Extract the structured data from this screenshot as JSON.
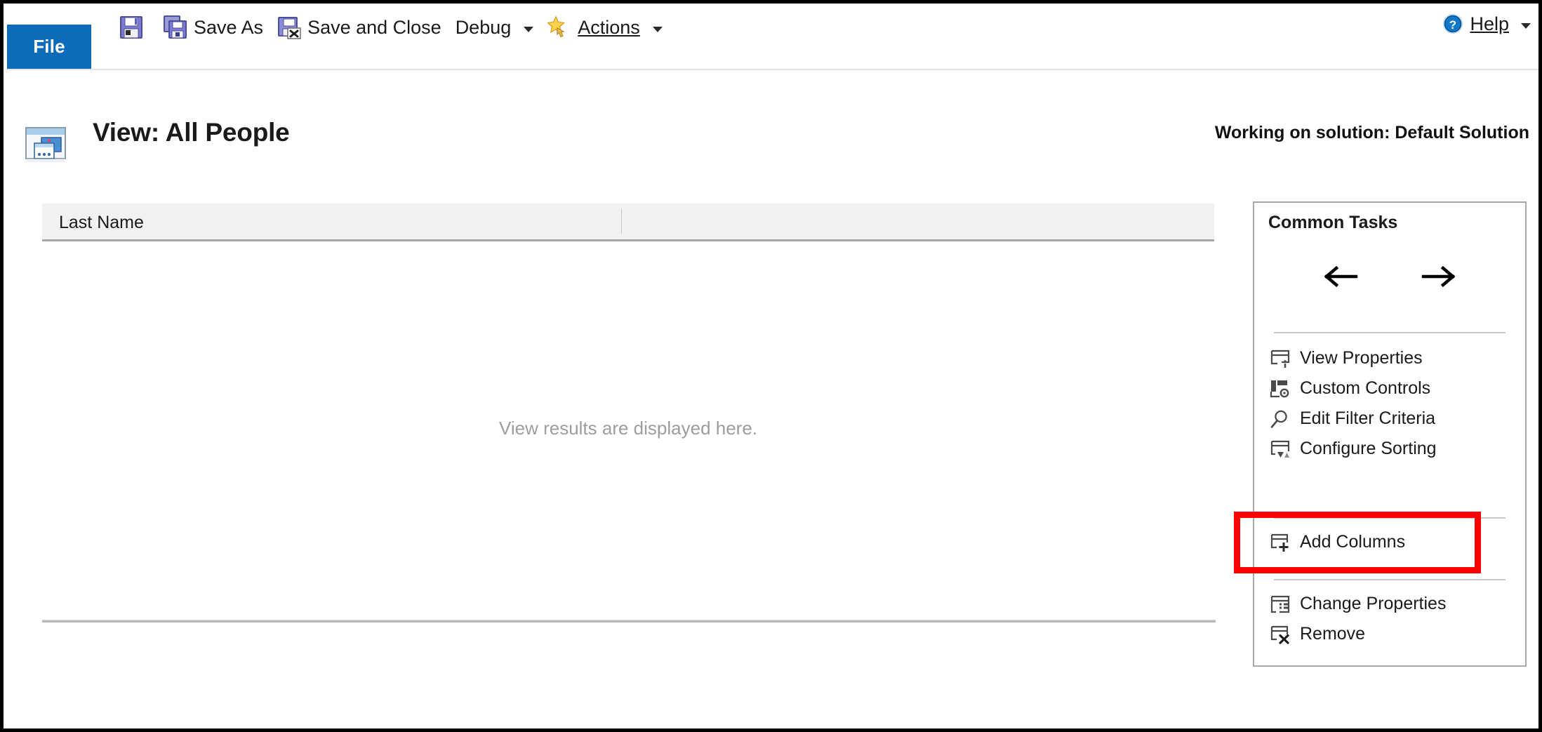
{
  "ribbon": {
    "file_tab": "File",
    "commands": [
      {
        "label": "",
        "icon": "save-icon",
        "has_caret": false
      },
      {
        "label": "Save As",
        "icon": "save-as-icon",
        "has_caret": false
      },
      {
        "label": "Save and Close",
        "icon": "save-and-close-icon",
        "has_caret": false
      },
      {
        "label": "Debug",
        "icon": "",
        "has_caret": true
      },
      {
        "label": "Actions",
        "icon": "actions-star-icon",
        "has_caret": true
      }
    ],
    "help": {
      "label": "Help",
      "icon": "help-question-icon",
      "has_caret": true
    }
  },
  "header": {
    "title": "View: All People",
    "icon": "view-window-icon",
    "solution_note": "Working on solution: Default Solution"
  },
  "grid": {
    "columns": [
      "Last Name"
    ],
    "empty_message": "View results are displayed here."
  },
  "common_tasks": {
    "title": "Common Tasks",
    "nav": {
      "back": "←",
      "forward": "→"
    },
    "group_a": [
      {
        "label": "View Properties",
        "icon": "view-properties-icon"
      },
      {
        "label": "Custom Controls",
        "icon": "custom-controls-icon"
      },
      {
        "label": "Edit Filter Criteria",
        "icon": "magnifier-icon"
      },
      {
        "label": "Configure Sorting",
        "icon": "sort-icon"
      }
    ],
    "group_b": [
      {
        "label": "Add Columns",
        "icon": "add-columns-icon"
      }
    ],
    "group_c": [
      {
        "label": "Change Properties",
        "icon": "change-properties-icon"
      },
      {
        "label": "Remove",
        "icon": "remove-column-icon"
      }
    ]
  },
  "annotation": {
    "highlight_target": "Add Columns",
    "highlight_color": "#FE0000"
  }
}
